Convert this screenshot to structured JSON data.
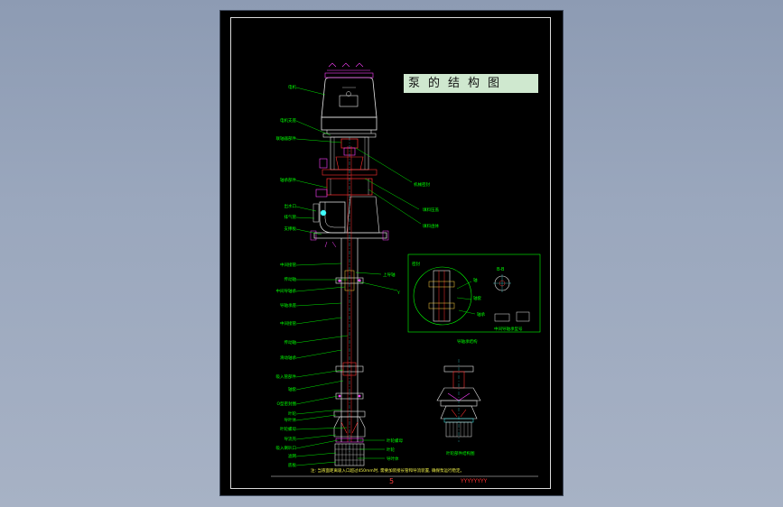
{
  "title": "泵的结构图",
  "page_number": "5",
  "drawing_code": "YYYYYYYY",
  "note": "注: 当液面距离吸入口超过450mm时, 需要加装接长管和导流装置, 确保泵运行稳定。",
  "labels_left": [
    "电机",
    "电机支座",
    "联轴器部件",
    "轴承部件",
    "出水口",
    "排气管",
    "支撑板",
    "中间接管",
    "传动轴",
    "中间导轴承",
    "导轴承座",
    "中间接管",
    "传动轴",
    "滑动轴承",
    "吸入管部件",
    "轴套",
    "O型密封圈",
    "叶轮",
    "导叶体",
    "叶轮螺母",
    "导流壳",
    "吸入喇叭口",
    "滤网",
    "底板"
  ],
  "labels_right": [
    "机械密封",
    "填料压盖",
    "填料函体",
    "上导轴",
    "Y"
  ],
  "labels_bottom_right": [
    "叶轮螺母",
    "叶轮",
    "导叶体"
  ],
  "detail_section": {
    "caption": "导轴承结构",
    "section_label": "B-B",
    "sub_label": "中间导轴承型号",
    "detail_tags": [
      "轴",
      "轴套",
      "轴承",
      "密封"
    ]
  },
  "pump_head_caption": "叶轮部件结构图",
  "colors": {
    "sheet_bg": "#000000",
    "line_green": "#00ff00",
    "line_white": "#e8e8e8",
    "line_red": "#ff3030",
    "line_magenta": "#ff40ff",
    "line_cyan": "#40ffff",
    "title_bg": "#cfe8cf"
  }
}
